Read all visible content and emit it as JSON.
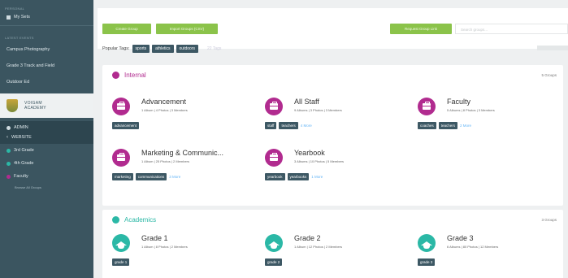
{
  "sidebar": {
    "top_caption": "Personal",
    "my_sets": "My Sets",
    "recent_caption": "Latest Events",
    "recent": [
      "Campus Photography",
      "Grade 3 Track and Field",
      "Outdoor Ed"
    ],
    "org_name_line1": "VOIGAM",
    "org_name_line2": "ACADEMY",
    "admin": "ADMIN",
    "website": "WEBSITE",
    "groups": [
      {
        "label": "3rd Grade",
        "color": "#2bb8a6"
      },
      {
        "label": "4th Grade",
        "color": "#2bb8a6"
      },
      {
        "label": "Faculty",
        "color": "#b12b8f"
      }
    ],
    "view_all": "Browse All Groups"
  },
  "toolbar": {
    "create_group": "Create Group",
    "import_groups": "Import Groups (CSV)",
    "request_group": "Request Group Link",
    "search_placeholder": "Search groups..."
  },
  "popular_tags": {
    "label": "Popular Tags:",
    "tags": [
      "sports",
      "athletics",
      "outdoors"
    ],
    "more": "22 Tags"
  },
  "sections": [
    {
      "title": "Internal",
      "color": "#b12b8f",
      "count": "5 Groups",
      "cards": [
        {
          "title": "Advancement",
          "meta": "1 Album | 4 Photos | 3 Members",
          "tags": [
            "advancement"
          ],
          "more": ""
        },
        {
          "title": "All Staff",
          "meta": "9 Albums | 3 Photos | 3 Members",
          "tags": [
            "staff",
            "teachers"
          ],
          "more": "4 More"
        },
        {
          "title": "Faculty",
          "meta": "5 Albums | 8 Photos | 3 Members",
          "tags": [
            "coaches",
            "teachers"
          ],
          "more": "2 More"
        },
        {
          "title": "Marketing & Communic...",
          "meta": "1 Album | 25 Photos | 2 Members",
          "tags": [
            "marketing",
            "communications"
          ],
          "more": "3 More"
        },
        {
          "title": "Yearbook",
          "meta": "3 Albums | 10 Photos | 5 Members",
          "tags": [
            "yearbook",
            "yearbooks"
          ],
          "more": "1 More"
        }
      ]
    },
    {
      "title": "Academics",
      "color": "#2bb8a6",
      "count": "3 Groups",
      "cards": [
        {
          "title": "Grade 1",
          "meta": "1 Album | 8 Photos | 2 Members",
          "tags": [
            "grade 1"
          ],
          "more": ""
        },
        {
          "title": "Grade 2",
          "meta": "1 Album | 12 Photos | 2 Members",
          "tags": [
            "grade 2"
          ],
          "more": ""
        },
        {
          "title": "Grade 3",
          "meta": "6 Albums | 80 Photos | 12 Members",
          "tags": [
            "grade 3"
          ],
          "more": ""
        }
      ]
    }
  ]
}
